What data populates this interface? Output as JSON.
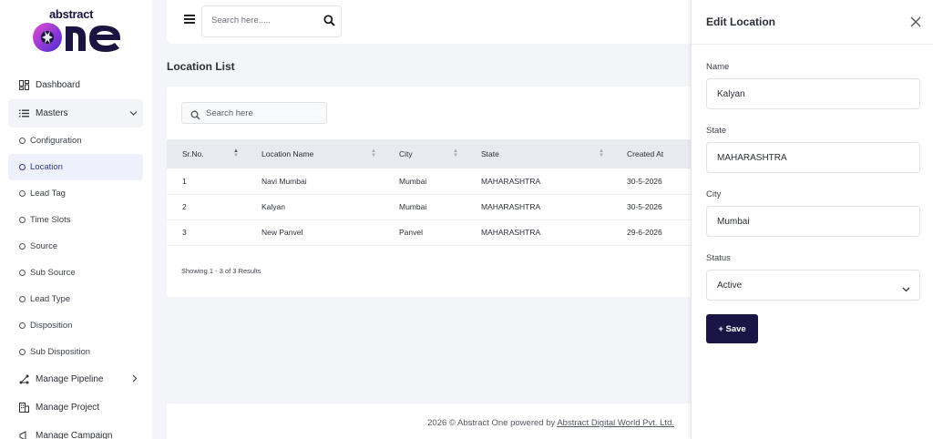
{
  "logo": {
    "small_text": "abstract",
    "big_text": "one"
  },
  "sidebar": {
    "items": [
      {
        "label": "Dashboard"
      },
      {
        "label": "Masters"
      },
      {
        "label": "Manage Pipeline"
      },
      {
        "label": "Manage Project"
      },
      {
        "label": "Manage Campaign"
      }
    ],
    "sub_items": [
      {
        "label": "Configuration"
      },
      {
        "label": "Location"
      },
      {
        "label": "Lead Tag"
      },
      {
        "label": "Time Slots"
      },
      {
        "label": "Source"
      },
      {
        "label": "Sub Source"
      },
      {
        "label": "Lead Type"
      },
      {
        "label": "Disposition"
      },
      {
        "label": "Sub Disposition"
      }
    ]
  },
  "topbar": {
    "search_placeholder": "Search here....."
  },
  "page": {
    "title": "Location List"
  },
  "table": {
    "search_placeholder": "Search here",
    "columns": [
      "Sr.No.",
      "Location Name",
      "City",
      "State",
      "Created At"
    ],
    "rows": [
      [
        "1",
        "Navi Mumbai",
        "Mumbai",
        "MAHARASHTRA",
        "30-5-2026"
      ],
      [
        "2",
        "Kalyan",
        "Mumbai",
        "MAHARASHTRA",
        "30-5-2026"
      ],
      [
        "3",
        "New Panvel",
        "Panvel",
        "MAHARASHTRA",
        "29-6-2026"
      ]
    ],
    "showing": "Showing 1 - 3 of 3 Results"
  },
  "footer": {
    "prefix": "2026 © Abstract One powered by ",
    "link": "Abstract Digital World Pvt. Ltd."
  },
  "panel": {
    "title": "Edit Location",
    "fields": [
      {
        "label": "Name",
        "value": "Kalyan"
      },
      {
        "label": "State",
        "value": "MAHARASHTRA"
      },
      {
        "label": "City",
        "value": "Mumbai"
      },
      {
        "label": "Status",
        "value": "Active"
      }
    ],
    "save_label": "+ Save"
  },
  "colors": {
    "brand_dark": "#1b1546",
    "logo_purple": "#6b3bd6",
    "active_bg": "#eef0fb"
  }
}
